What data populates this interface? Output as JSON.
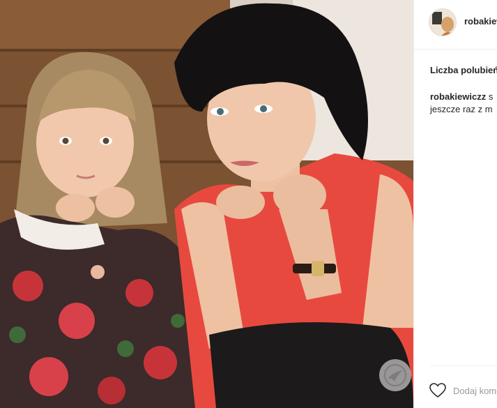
{
  "post": {
    "username": "robakiewiczz",
    "likes_label": "Liczba polubień",
    "caption": {
      "user": "robakiewiczz",
      "text_line1": "s",
      "text_line2": "jeszcze raz z m"
    }
  },
  "actions": {
    "like_icon": "heart-outline-icon",
    "comment_placeholder": "Dodaj komentarz..."
  },
  "colors": {
    "border": "#efefef",
    "text": "#262626",
    "muted": "#999999",
    "photo_background": "#7b5232",
    "dress_red": "#e8493f"
  }
}
